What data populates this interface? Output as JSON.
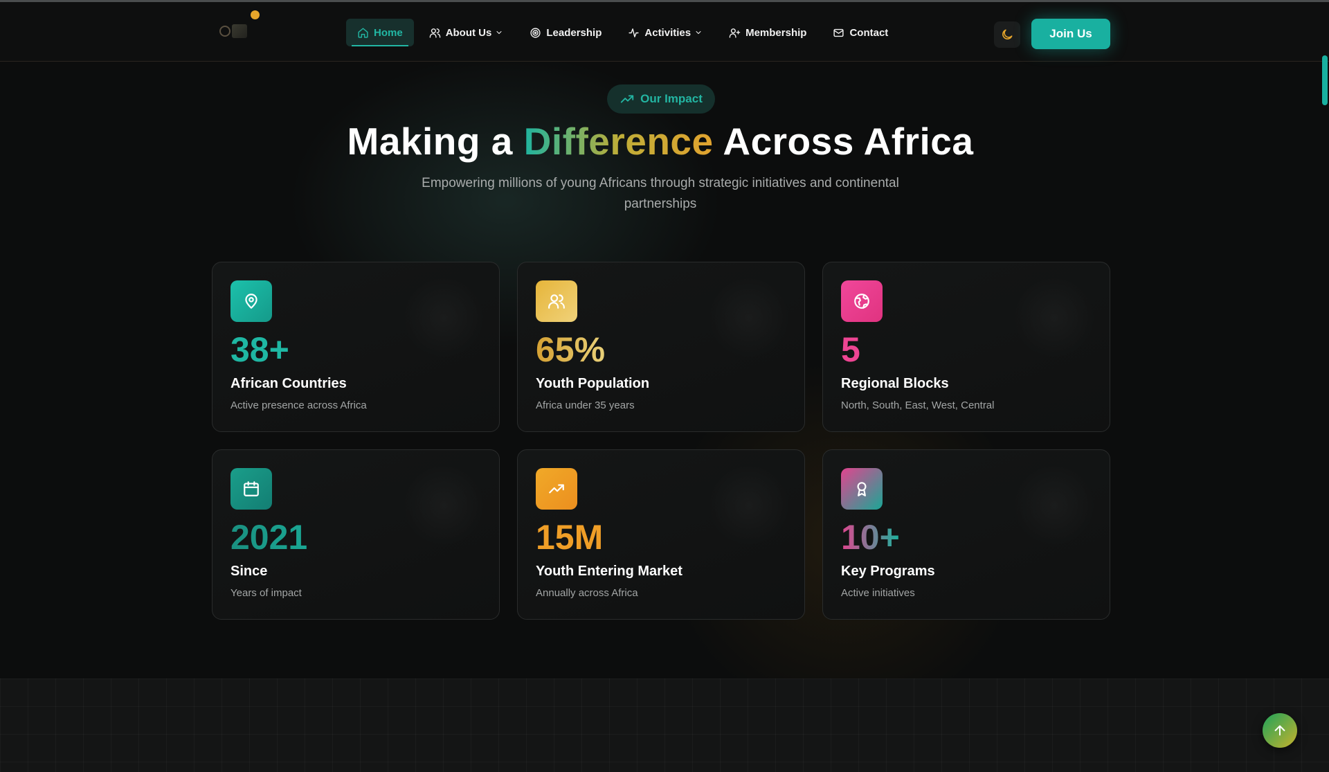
{
  "nav": {
    "items": [
      {
        "label": "Home",
        "icon": "home-icon",
        "active": true
      },
      {
        "label": "About Us",
        "icon": "users-icon",
        "dropdown": true
      },
      {
        "label": "Leadership",
        "icon": "target-icon"
      },
      {
        "label": "Activities",
        "icon": "activity-icon",
        "dropdown": true
      },
      {
        "label": "Membership",
        "icon": "user-plus-icon"
      },
      {
        "label": "Contact",
        "icon": "mail-icon"
      }
    ],
    "join_label": "Join Us",
    "theme_icon": "moon-icon"
  },
  "hero": {
    "badge": "Our Impact",
    "title_before": "Making a ",
    "title_accent": "Difference",
    "title_after": " Across Africa",
    "subtitle": "Empowering millions of young Africans through strategic initiatives and continental partnerships"
  },
  "stats": [
    {
      "value": "38+",
      "label": "African Countries",
      "desc": "Active presence across Africa",
      "icon": "map-pin-icon",
      "color": "#1fb7a3"
    },
    {
      "value": "65%",
      "label": "Youth Population",
      "desc": "Africa under 35 years",
      "icon": "users-icon",
      "color": "#e2b23f"
    },
    {
      "value": "5",
      "label": "Regional Blocks",
      "desc": "North, South, East, West, Central",
      "icon": "globe-icon",
      "color": "#ee4593"
    },
    {
      "value": "2021",
      "label": "Since",
      "desc": "Years of impact",
      "icon": "calendar-icon",
      "color": "#1a9080"
    },
    {
      "value": "15M",
      "label": "Youth Entering Market",
      "desc": "Annually across Africa",
      "icon": "trending-up-icon",
      "color": "#ef9e27"
    },
    {
      "value": "10+",
      "label": "Key Programs",
      "desc": "Active initiatives",
      "icon": "award-icon",
      "color": "#e0458f"
    }
  ],
  "colors": {
    "accent": "#19b0a0",
    "gold": "#e7a62b",
    "background": "#0c0d0d"
  }
}
